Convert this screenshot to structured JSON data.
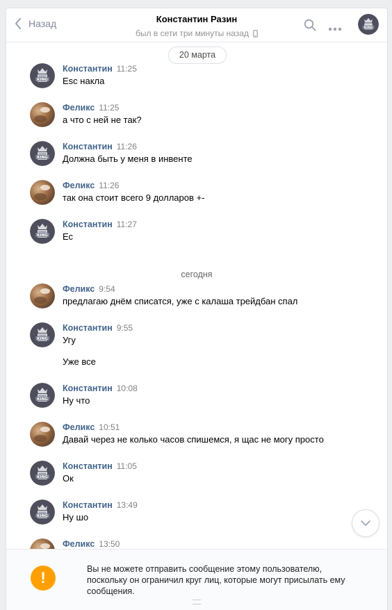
{
  "header": {
    "back_label": "Назад",
    "contact_name": "Константин Разин",
    "status": "был в сети три минуты назад",
    "icons": [
      "back-chevron-icon",
      "phone-icon",
      "search-icon",
      "more-icon"
    ]
  },
  "feed": {
    "date_pill": "20 марта",
    "day_separator": "сегодня",
    "messages": [
      {
        "author": "Константин",
        "time": "11:25",
        "lines": [
          "Esc накла"
        ]
      },
      {
        "author": "Феликс",
        "time": "11:25",
        "lines": [
          "а что с ней не так?"
        ]
      },
      {
        "author": "Константин",
        "time": "11:26",
        "lines": [
          "Должна быть у меня в инвенте"
        ]
      },
      {
        "author": "Феликс",
        "time": "11:26",
        "lines": [
          "так она стоит всего 9 долларов +-"
        ]
      },
      {
        "author": "Константин",
        "time": "11:27",
        "lines": [
          "Ес"
        ]
      },
      {
        "author": "Феликс",
        "time": "9:54",
        "lines": [
          "предлагаю днём списатся, уже с калаша трейдбан спал"
        ]
      },
      {
        "author": "Константин",
        "time": "9:55",
        "lines": [
          "Угу",
          "Уже все"
        ]
      },
      {
        "author": "Константин",
        "time": "10:08",
        "lines": [
          "Ну что"
        ]
      },
      {
        "author": "Феликс",
        "time": "10:51",
        "lines": [
          "Давай через не колько часов спишемся, я щас не могу просто"
        ]
      },
      {
        "author": "Константин",
        "time": "11:05",
        "lines": [
          "Ок"
        ]
      },
      {
        "author": "Константин",
        "time": "13:49",
        "lines": [
          "Ну шо"
        ]
      },
      {
        "author": "Феликс",
        "time": "13:50",
        "lines": []
      }
    ]
  },
  "notice": {
    "icon": "warning-icon",
    "glyph": "!",
    "text": "Вы не можете отправить сообщение этому пользователю, поскольку он ограничил круг лиц, которые могут присылать ему сообщения."
  },
  "colors": {
    "author": "#42648b",
    "warning": "#ffa000",
    "background": "#edeef0"
  }
}
